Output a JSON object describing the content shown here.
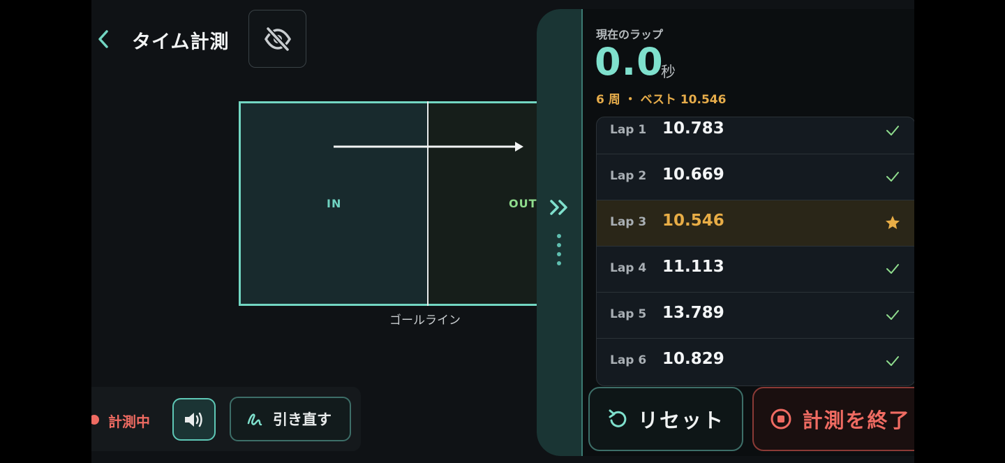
{
  "header": {
    "back_icon": "chevron-left-icon",
    "title": "タイム計測",
    "visibility_icon": "eye-off-icon"
  },
  "diagram": {
    "in_label": "IN",
    "out_label": "OUT",
    "goal_caption": "ゴールライン",
    "direction_icon": "arrow-right-icon"
  },
  "bottom_bar": {
    "status_label": "計測中",
    "sound_icon": "speaker-icon",
    "redraw_label": "引き直す",
    "redraw_icon": "squiggle-icon"
  },
  "panel": {
    "collapse_icon": "double-chevron-right-icon",
    "current_lap_label": "現在のラップ",
    "current_value": "0.0",
    "current_unit": "秒",
    "summary": "6 周 ・ ベスト 10.546",
    "laps": [
      {
        "name": "Lap 1",
        "time": "10.783",
        "icon": "check-icon",
        "best": false
      },
      {
        "name": "Lap 2",
        "time": "10.669",
        "icon": "check-icon",
        "best": false
      },
      {
        "name": "Lap 3",
        "time": "10.546",
        "icon": "star-icon",
        "best": true
      },
      {
        "name": "Lap 4",
        "time": "11.113",
        "icon": "check-icon",
        "best": false
      },
      {
        "name": "Lap 5",
        "time": "13.789",
        "icon": "check-icon",
        "best": false
      },
      {
        "name": "Lap 6",
        "time": "10.829",
        "icon": "check-icon",
        "best": false
      }
    ],
    "reset_label": "リセット",
    "end_label": "計測を終了"
  },
  "colors": {
    "accent": "#72d6c2",
    "best": "#e8ad46",
    "recording": "#ef6b62",
    "check": "#8fdc8d"
  }
}
